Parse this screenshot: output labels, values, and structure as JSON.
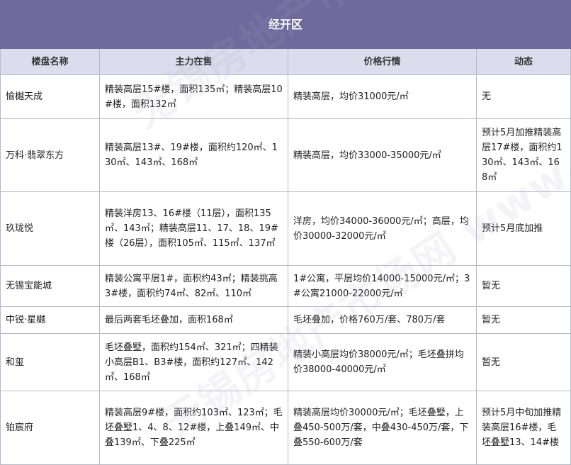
{
  "table": {
    "title": "经开区",
    "headers": [
      "楼盘名称",
      "主力在售",
      "价格行情",
      "动态"
    ],
    "rows": [
      {
        "name": "愉樾天成",
        "selling": "精装高层15#楼，面积135㎡；精装高层10#楼，面积132㎡",
        "price": "精装高层，均价31000元/㎡",
        "status": "无"
      },
      {
        "name": "万科·翡翠东方",
        "selling": "精装高层13#、19#楼，面积约120㎡、130㎡、143㎡、168㎡",
        "price": "精装高层，均价33000-35000元/㎡",
        "status": "预计5月加推精装高层17#楼，面积约130㎡、143㎡、168㎡"
      },
      {
        "name": "玖珑悦",
        "selling": "精装洋房13、16#楼（11层），面积135㎡、143㎡；精装高层11、17、18、19#楼（26层），面积105㎡、115㎡、137㎡",
        "price": "洋房，均价34000-36000元/㎡；高层，均价30000-32000元/㎡",
        "status": "预计5月底加推"
      },
      {
        "name": "无锡宝能城",
        "selling": "精装公寓平层1#，面积约43㎡；精装挑高3#楼，面积约74㎡、82㎡、110㎡",
        "price": "1#公寓，平层均价14000-15000元/㎡；3#公寓21000-22000元/㎡",
        "status": "暂无"
      },
      {
        "name": "中锐·星樾",
        "selling": "最后两套毛坯叠加，面积168㎡",
        "price": "毛坯叠加，价格760万/套、780万/套",
        "status": "暂无"
      },
      {
        "name": "和玺",
        "selling": "毛坯叠墅，面积约154㎡、321㎡；四精装小高层B1、B3#楼，面积约127㎡、142㎡、168㎡",
        "price": "精装小高层均价38000元/㎡；毛坯叠拼均价38000-40000元/㎡",
        "status": "暂无"
      },
      {
        "name": "铂宸府",
        "selling": "精装高层9#楼，面积约103㎡、123㎡；毛坯叠墅1、4、8、12#楼，上叠149㎡、中叠139㎡、下叠225㎡",
        "price": "精装高层均价30000元/㎡；毛坯叠墅，上叠450-500万/套，中叠430-450万/套，下叠550-600万/套",
        "status": "预计5月中旬加推精装高层16#楼，毛坯叠墅13、14#楼"
      }
    ]
  },
  "watermark": "无锡房地产市场网 www.xhouse.com"
}
